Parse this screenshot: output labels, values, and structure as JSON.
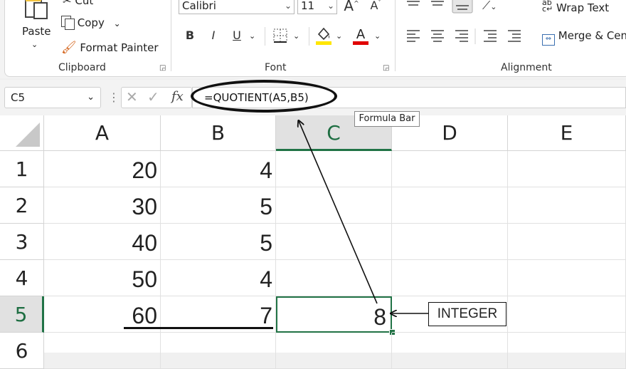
{
  "ribbon": {
    "clipboard": {
      "cut_label": "Cut",
      "paste_label": "Paste",
      "copy_label": "Copy",
      "format_painter_label": "Format Painter",
      "group_label": "Clipboard"
    },
    "font": {
      "font_name": "Calibri",
      "font_size": "11",
      "group_label": "Font",
      "highlight_color": "#ffe600",
      "font_color": "#e00000"
    },
    "alignment": {
      "wrap_text_label": "Wrap Text",
      "merge_label": "Merge & Center",
      "group_label": "Alignment"
    }
  },
  "formula_bar": {
    "name_box": "C5",
    "formula": "=QUOTIENT(A5,B5)",
    "fx_label": "fx",
    "tooltip": "Formula Bar"
  },
  "grid": {
    "columns": [
      "A",
      "B",
      "C",
      "D",
      "E"
    ],
    "selected_column": "C",
    "rows": [
      {
        "num": "1",
        "a": "20",
        "b": "4",
        "c": ""
      },
      {
        "num": "2",
        "a": "30",
        "b": "5",
        "c": ""
      },
      {
        "num": "3",
        "a": "40",
        "b": "5",
        "c": ""
      },
      {
        "num": "4",
        "a": "50",
        "b": "4",
        "c": ""
      },
      {
        "num": "5",
        "a": "60",
        "b": "7",
        "c": "8"
      },
      {
        "num": "6",
        "a": "",
        "b": "",
        "c": ""
      }
    ],
    "selected_row": "5",
    "accent_color": "#217346"
  },
  "annotation": {
    "label": "INTEGER"
  }
}
